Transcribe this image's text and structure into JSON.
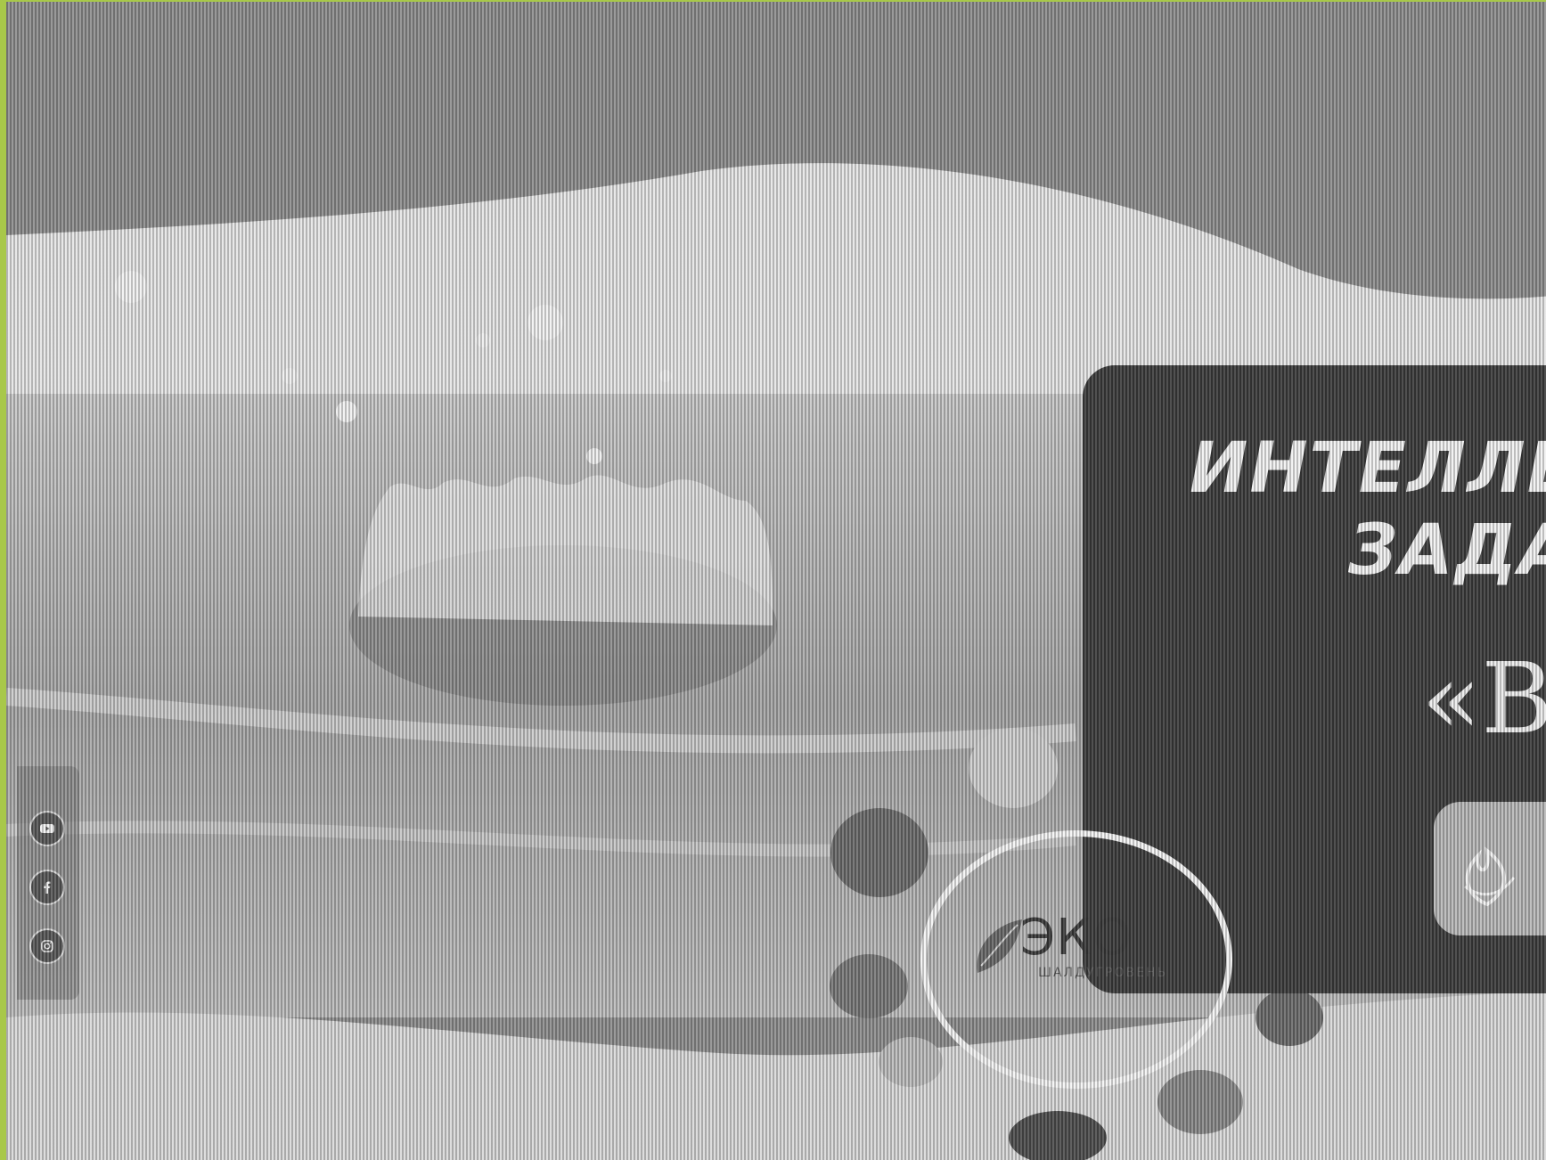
{
  "social": {
    "items": [
      {
        "icon": "youtube-icon"
      },
      {
        "icon": "facebook-icon"
      },
      {
        "icon": "instagram-icon"
      }
    ]
  },
  "hero_panel": {
    "title_line1": "ИНТЕЛЛЕК",
    "title_line2": "ЗАДА",
    "quote_text": "«Во"
  },
  "eco_logo": {
    "text": "ЭКО",
    "subtext": "ШАЛДУГРОВЕНЬ"
  },
  "colors": {
    "frame_accent": "#a8c84a",
    "panel_bg": "#3d3d3d"
  }
}
